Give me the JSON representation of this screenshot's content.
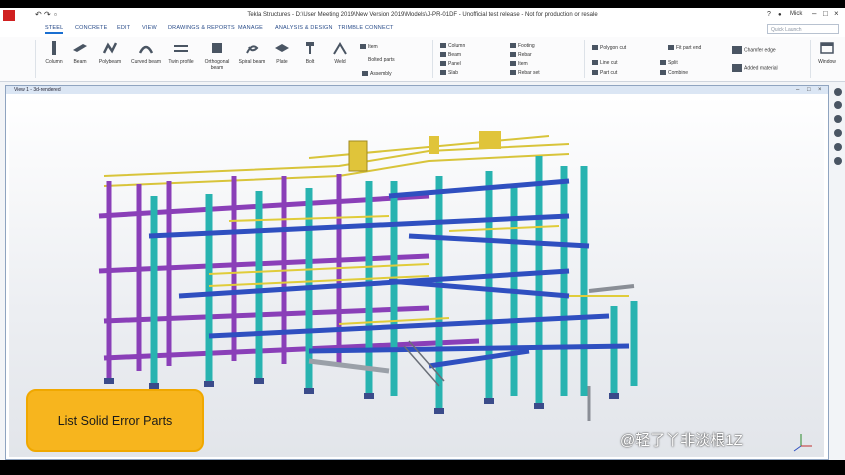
{
  "titlebar": {
    "title": "Tekla Structures - D:\\User Meeting 2019\\New Version 2019\\Models\\J-PR-01DF - Unofficial test release - Not for production or resale",
    "user": "Mick"
  },
  "tabs": [
    "STEEL",
    "CONCRETE",
    "EDIT",
    "VIEW",
    "DRAWINGS & REPORTS",
    "MANAGE",
    "ANALYSIS & DESIGN",
    "TRIMBLE CONNECT"
  ],
  "quick_launch": {
    "placeholder": "Quick Launch"
  },
  "ribbon": {
    "steel_buttons": [
      "Column",
      "Beam",
      "Polybeam",
      "Curved beam",
      "Twin profile",
      "Orthogonal beam",
      "Spiral beam",
      "Plate",
      "Bolt",
      "Weld"
    ],
    "items_group": [
      "Item",
      "Bolted parts",
      "Assembly"
    ],
    "concrete_group": [
      "Column",
      "Beam",
      "Panel",
      "Slab"
    ],
    "concrete_group2": [
      "Footing",
      "Rebar",
      "Item",
      "Rebar set"
    ],
    "cut_group": [
      "Polygon cut",
      "Line cut",
      "Part cut",
      "Fit part end",
      "Split",
      "Combine"
    ],
    "material_group": [
      "Chamfer edge",
      "Added material"
    ],
    "window_label": "Window"
  },
  "view": {
    "title": "View 1 - 3d-rendered"
  },
  "callout": {
    "text": "List Solid Error Parts"
  },
  "watermark": {
    "text": "@轻了丫非淡根1Z"
  },
  "colors": {
    "purple": "#8a3fb8",
    "teal": "#28b3b0",
    "blue": "#2f4fc0",
    "yellow": "#e0cc3a",
    "callout": "#f7b51e"
  }
}
